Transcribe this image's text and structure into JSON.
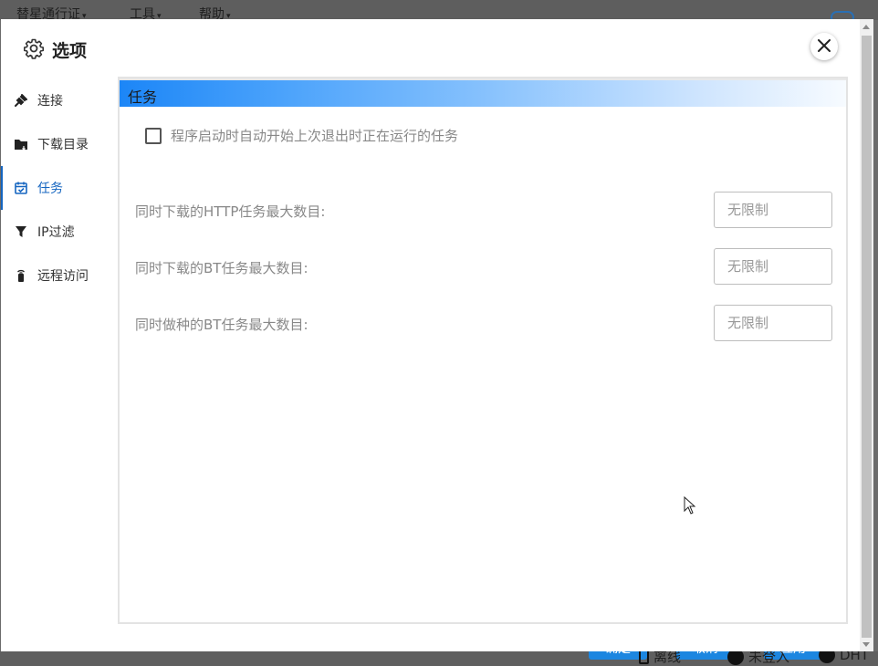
{
  "background": {
    "menus": [
      "替星通行证",
      "工具",
      "帮助"
    ],
    "buttons": [
      "确定",
      "取消",
      "应用"
    ],
    "status": [
      "离线",
      "未登入",
      "DHT"
    ]
  },
  "dialog": {
    "title": "选项",
    "close_icon": "close-icon"
  },
  "sidebar": {
    "items": [
      {
        "label": "连接",
        "icon": "plug-icon"
      },
      {
        "label": "下载目录",
        "icon": "folder-icon"
      },
      {
        "label": "任务",
        "icon": "calendar-check-icon",
        "active": true
      },
      {
        "label": "IP过滤",
        "icon": "filter-icon"
      },
      {
        "label": "远程访问",
        "icon": "remote-icon"
      }
    ]
  },
  "section": {
    "title": "任务",
    "checkbox_label": "程序启动时自动开始上次退出时正在运行的任务",
    "checkbox_checked": false,
    "fields": [
      {
        "label": "同时下载的HTTP任务最大数目:",
        "placeholder": "无限制"
      },
      {
        "label": "同时下载的BT任务最大数目:",
        "placeholder": "无限制"
      },
      {
        "label": "同时做种的BT任务最大数目:",
        "placeholder": "无限制"
      }
    ]
  },
  "colors": {
    "accent": "#1565c0",
    "header_gradient_start": "#1c86f7",
    "button_blue": "#1c86e0"
  }
}
